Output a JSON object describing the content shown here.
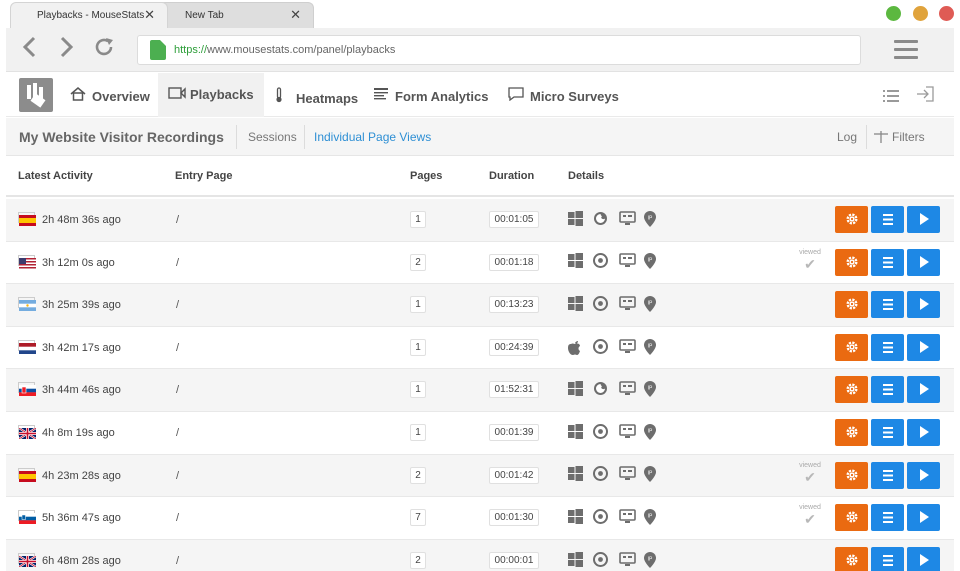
{
  "browser": {
    "tabs": [
      {
        "label": "Playbacks - MouseStats",
        "close": "✕"
      },
      {
        "label": "New Tab",
        "close": "✕"
      }
    ],
    "url_protocol": "https://",
    "url_rest": "www.mousestats.com/panel/playbacks",
    "traffic_lights": [
      "#5cb840",
      "#e0a33c",
      "#df5b55"
    ]
  },
  "appnav": {
    "items": [
      {
        "label": "Overview",
        "icon": "home-icon"
      },
      {
        "label": "Playbacks",
        "icon": "video-icon"
      },
      {
        "label": "Heatmaps",
        "icon": "thermometer-icon"
      },
      {
        "label": "Form Analytics",
        "icon": "form-icon"
      },
      {
        "label": "Micro Surveys",
        "icon": "chat-icon"
      }
    ]
  },
  "subhead": {
    "title": "My Website Visitor Recordings",
    "sessions": "Sessions",
    "page_views": "Individual Page Views",
    "log": "Log",
    "filters": "Filters"
  },
  "table": {
    "headers": {
      "activity": "Latest Activity",
      "entry": "Entry Page",
      "pages": "Pages",
      "duration": "Duration",
      "details": "Details"
    },
    "viewed_label": "viewed",
    "rows": [
      {
        "country": "es",
        "activity": "2h 48m 36s ago",
        "entry": "/",
        "pages": "1",
        "duration": "00:01:05",
        "os": "windows",
        "browser": "firefox",
        "viewed": false
      },
      {
        "country": "us",
        "activity": "3h 12m 0s ago",
        "entry": "/",
        "pages": "2",
        "duration": "00:01:18",
        "os": "windows",
        "browser": "chrome",
        "viewed": true
      },
      {
        "country": "ar",
        "activity": "3h 25m 39s ago",
        "entry": "/",
        "pages": "1",
        "duration": "00:13:23",
        "os": "windows",
        "browser": "chrome",
        "viewed": false
      },
      {
        "country": "nl",
        "activity": "3h 42m 17s ago",
        "entry": "/",
        "pages": "1",
        "duration": "00:24:39",
        "os": "apple",
        "browser": "chrome",
        "viewed": false
      },
      {
        "country": "sk",
        "activity": "3h 44m 46s ago",
        "entry": "/",
        "pages": "1",
        "duration": "01:52:31",
        "os": "windows",
        "browser": "firefox",
        "viewed": false
      },
      {
        "country": "gb",
        "activity": "4h 8m 19s ago",
        "entry": "/",
        "pages": "1",
        "duration": "00:01:39",
        "os": "windows",
        "browser": "chrome",
        "viewed": false
      },
      {
        "country": "es",
        "activity": "4h 23m 28s ago",
        "entry": "/",
        "pages": "2",
        "duration": "00:01:42",
        "os": "windows",
        "browser": "chrome",
        "viewed": true
      },
      {
        "country": "si",
        "activity": "5h 36m 47s ago",
        "entry": "/",
        "pages": "7",
        "duration": "00:01:30",
        "os": "windows",
        "browser": "chrome",
        "viewed": true
      },
      {
        "country": "gb",
        "activity": "6h 48m 28s ago",
        "entry": "/",
        "pages": "2",
        "duration": "00:00:01",
        "os": "windows",
        "browser": "chrome",
        "viewed": false
      }
    ]
  },
  "colors": {
    "orange": "#ea6a11",
    "blue": "#1e88e5",
    "link_blue": "#2e8fd4"
  }
}
